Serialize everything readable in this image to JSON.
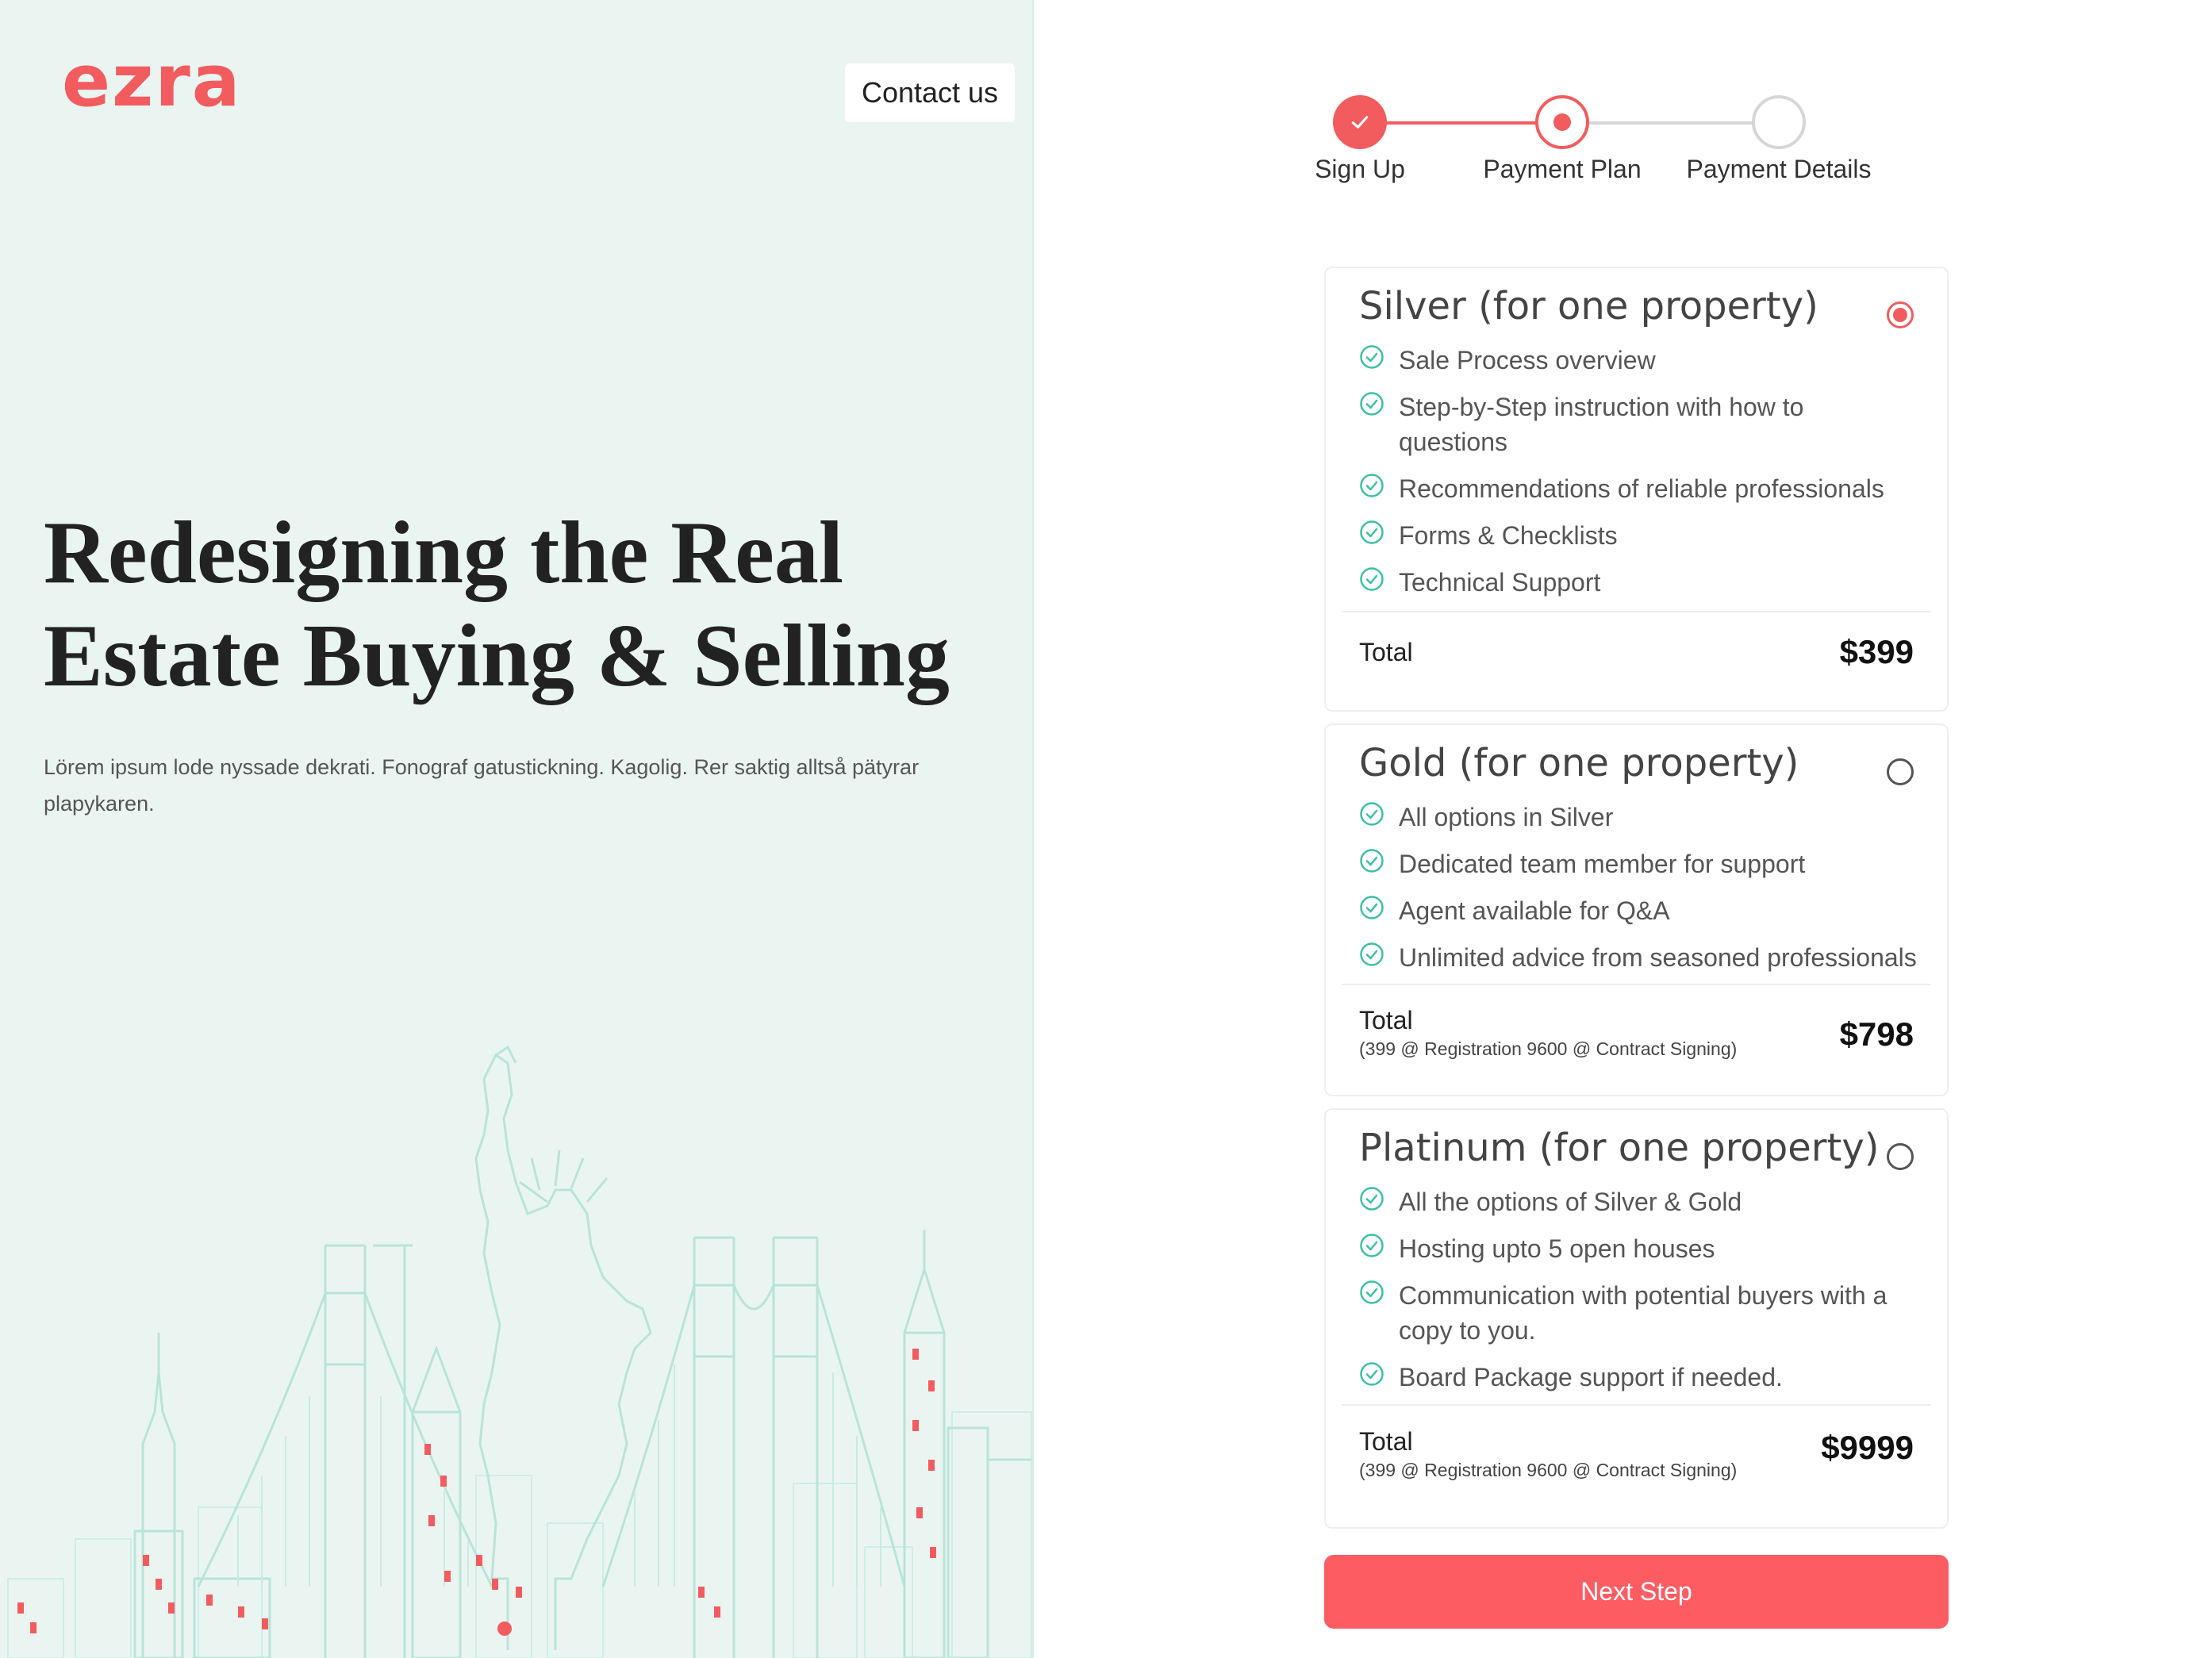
{
  "brand": {
    "logo": "ezra",
    "accent": "#f25c5f",
    "teal": "#3dbfa5",
    "panel_bg": "#eaf5f2"
  },
  "header": {
    "contact_label": "Contact us"
  },
  "hero": {
    "title": "Redesigning the Real Estate Buying & Selling",
    "subtitle": "Lörem ipsum lode nyssade dekrati. Fonograf gatustickning. Kagolig. Rer saktig alltså pätyrar plapykaren."
  },
  "stepper": {
    "steps": [
      {
        "label": "Sign Up",
        "state": "completed"
      },
      {
        "label": "Payment Plan",
        "state": "active"
      },
      {
        "label": "Payment Details",
        "state": "pending"
      }
    ]
  },
  "plans": [
    {
      "title": "Silver (for one property)",
      "selected": true,
      "features": [
        "Sale Process overview",
        "Step-by-Step instruction with how to questions",
        "Recommendations of reliable professionals",
        "Forms & Checklists",
        "Technical Support"
      ],
      "total_label": "Total",
      "total_note": "",
      "price": "$399"
    },
    {
      "title": "Gold (for one property)",
      "selected": false,
      "features": [
        "All options in Silver",
        "Dedicated team member for support",
        "Agent available for Q&A",
        "Unlimited advice from seasoned professionals"
      ],
      "total_label": "Total",
      "total_note": "(399 @ Registration 9600 @ Contract Signing)",
      "price": "$798"
    },
    {
      "title": "Platinum (for one property)",
      "selected": false,
      "features": [
        "All the options of Silver & Gold",
        "Hosting upto 5 open houses",
        "Communication with potential buyers with a copy to you.",
        "Board Package support if needed."
      ],
      "total_label": "Total",
      "total_note": "(399 @ Registration 9600 @ Contract Signing)",
      "price": "$9999"
    }
  ],
  "actions": {
    "next_label": "Next Step"
  }
}
